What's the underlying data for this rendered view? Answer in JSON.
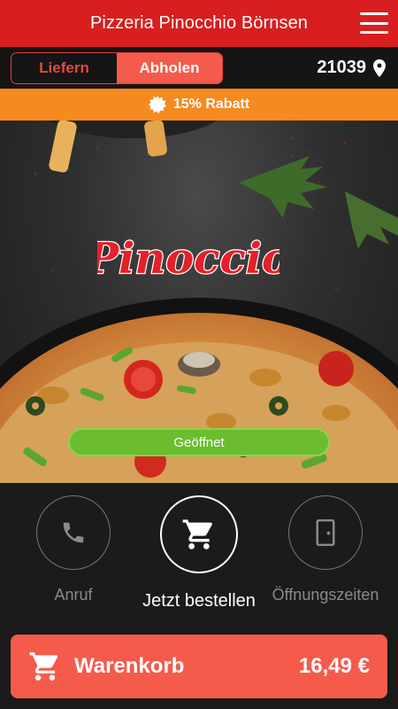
{
  "header": {
    "title": "Pizzeria Pinocchio Börnsen",
    "menu_icon": "hamburger-menu-icon"
  },
  "mode": {
    "delivery_label": "Liefern",
    "pickup_label": "Abholen",
    "selected": "Abholen"
  },
  "location": {
    "zip": "21039",
    "icon": "location-pin-icon"
  },
  "promo": {
    "text": "15% Rabatt",
    "icon": "badge-icon"
  },
  "hero": {
    "logo_text": "Pinoccio",
    "status_label": "Geöffnet",
    "status_color": "#6bbd2d"
  },
  "actions": {
    "call_label": "Anruf",
    "order_label": "Jetzt bestellen",
    "hours_label": "Öffnungszeiten"
  },
  "cart": {
    "label": "Warenkorb",
    "price": "16,49 €",
    "icon": "shopping-cart-icon"
  },
  "colors": {
    "brand_red": "#d81e1e",
    "accent": "#f45b4a",
    "promo_orange": "#f58a1f"
  }
}
